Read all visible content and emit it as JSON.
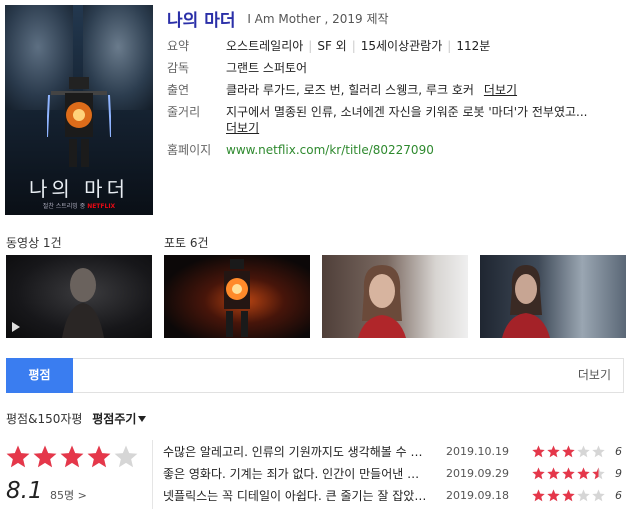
{
  "movie": {
    "title": "나의 마더",
    "subtitle": "I Am Mother , 2019 제작",
    "poster_title": "나의 마더",
    "poster_sub": "절찬 스트리밍 중",
    "poster_brand": "NETFLIX"
  },
  "info": {
    "summary_label": "요약",
    "summary": [
      "오스트레일리아",
      "SF 외",
      "15세이상관람가",
      "112분"
    ],
    "director_label": "감독",
    "director": "그랜트 스퍼토어",
    "cast_label": "출연",
    "cast": "클라라 루가드, 로즈 번, 힐러리 스웽크, 루크 호커",
    "cast_more": "더보기",
    "plot_label": "줄거리",
    "plot": "지구에서 멸종된 인류, 소녀에겐 자신을 키워준 로봇 '마더'가 전부였고...",
    "plot_more": "더보기",
    "homepage_label": "홈페이지",
    "homepage": "www.netflix.com/kr/title/80227090"
  },
  "media": {
    "video_label": "동영상 1건",
    "photo_label": "포토 6건"
  },
  "tabs": {
    "active": "평점",
    "more": "더보기"
  },
  "rating": {
    "header": "평점&150자평",
    "give_label": "평점주기",
    "average": "8.1",
    "average_stars": 4,
    "count": "85명",
    "count_arrow": ">"
  },
  "reviews": [
    {
      "text": "수많은 알레고리. 인류의 기원까지도 생각해볼 수 있는 작품",
      "date": "2019.10.19",
      "score": "6",
      "stars": 3
    },
    {
      "text": "좋은 영화다. 기계는 죄가 없다. 인간이 만들어낸 것일 뿐",
      "date": "2019.09.29",
      "score": "9",
      "stars": 4.5
    },
    {
      "text": "넷플릭스는 꼭 디테일이 아쉽다. 큰 줄기는 잘 잡았는데",
      "date": "2019.09.18",
      "score": "6",
      "stars": 3
    }
  ],
  "colors": {
    "accent_blue": "#3a7df0",
    "star_red": "#e5374a",
    "title_blue": "#2a2fa8",
    "link_green": "#2f8a2f"
  }
}
